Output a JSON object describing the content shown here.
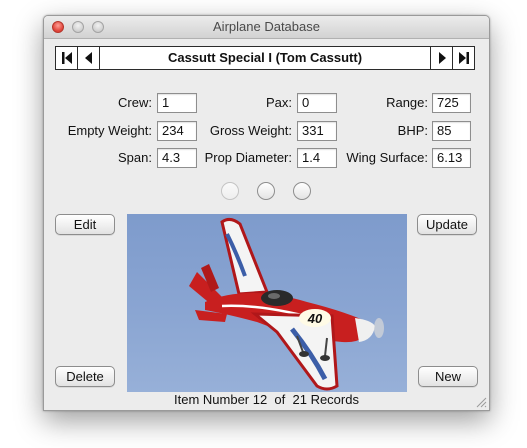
{
  "window": {
    "title": "Airplane Database"
  },
  "navigation": {
    "record_title": "Cassutt Special I (Tom Cassutt)",
    "first_icon": "skip-to-first-icon",
    "prev_icon": "play-left-icon",
    "next_icon": "play-right-icon",
    "last_icon": "skip-to-last-icon"
  },
  "fields": {
    "crew": {
      "label": "Crew:",
      "value": "1"
    },
    "pax": {
      "label": "Pax:",
      "value": "0"
    },
    "range": {
      "label": "Range:",
      "value": "725"
    },
    "empty_weight": {
      "label": "Empty Weight:",
      "value": "234"
    },
    "gross_weight": {
      "label": "Gross Weight:",
      "value": "331"
    },
    "bhp": {
      "label": "BHP:",
      "value": "85"
    },
    "span": {
      "label": "Span:",
      "value": "4.3"
    },
    "prop_diameter": {
      "label": "Prop Diameter:",
      "value": "1.4"
    },
    "wing_surface": {
      "label": "Wing Surface:",
      "value": "6.13"
    }
  },
  "radio_group": {
    "count": 3,
    "selected": null
  },
  "buttons": {
    "edit": "Edit",
    "update": "Update",
    "delete": "Delete",
    "new": "New"
  },
  "photo": {
    "race_number": "40",
    "sky_color": "#8aa5d2",
    "aircraft_color": "#c81f1f"
  },
  "footer": {
    "text": "Item Number 12  of  21 Records"
  }
}
